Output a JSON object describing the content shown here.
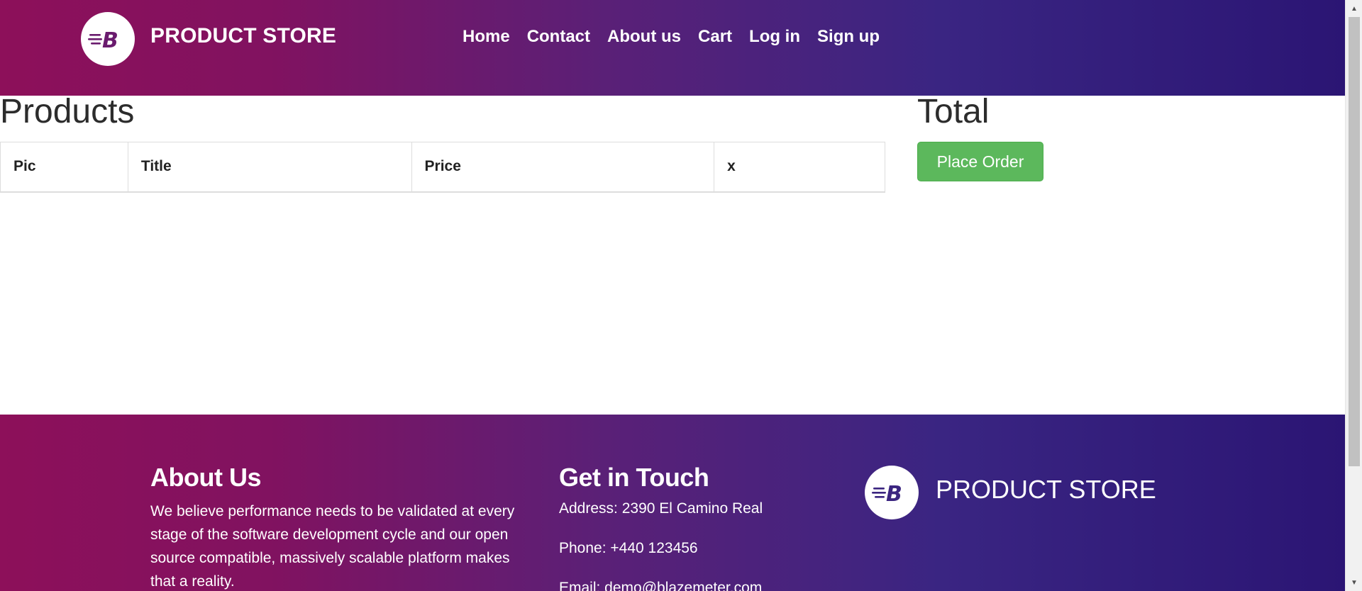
{
  "header": {
    "brand_name": "PRODUCT STORE",
    "logo_icon": "bolt-b-logo-icon",
    "nav": [
      {
        "label": "Home"
      },
      {
        "label": "Contact"
      },
      {
        "label": "About us"
      },
      {
        "label": "Cart"
      },
      {
        "label": "Log in"
      },
      {
        "label": "Sign up"
      }
    ]
  },
  "main": {
    "products_heading": "Products",
    "table_headers": [
      "Pic",
      "Title",
      "Price",
      "x"
    ],
    "total_heading": "Total",
    "place_order_label": "Place Order"
  },
  "footer": {
    "about_heading": "About Us",
    "about_text": "We believe performance needs to be validated at every stage of the software development cycle and our open source compatible, massively scalable platform makes that a reality.",
    "contact_heading": "Get in Touch",
    "address": "Address: 2390 El Camino Real",
    "phone": "Phone: +440 123456",
    "email": "Email: demo@blazemeter.com",
    "brand_name": "PRODUCT STORE"
  },
  "colors": {
    "gradient_start": "#8d105a",
    "gradient_end": "#2b1574",
    "button_green": "#5cb85c"
  }
}
